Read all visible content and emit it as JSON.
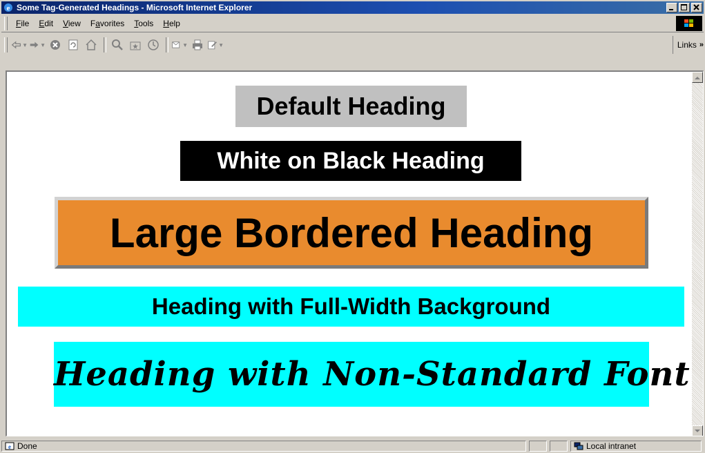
{
  "window": {
    "title": "Some Tag-Generated Headings - Microsoft Internet Explorer"
  },
  "title_buttons": {
    "minimize_icon": "minimize-icon",
    "maximize_icon": "maximize-icon",
    "close_icon": "close-icon"
  },
  "menu": {
    "items": [
      {
        "pre": "",
        "key": "F",
        "post": "ile"
      },
      {
        "pre": "",
        "key": "E",
        "post": "dit"
      },
      {
        "pre": "",
        "key": "V",
        "post": "iew"
      },
      {
        "pre": "F",
        "key": "a",
        "post": "vorites"
      },
      {
        "pre": "",
        "key": "T",
        "post": "ools"
      },
      {
        "pre": "",
        "key": "H",
        "post": "elp"
      }
    ]
  },
  "toolbar": {
    "links_label": "Links",
    "links_chevron": "»",
    "icons": [
      "back-icon",
      "forward-icon",
      "stop-icon",
      "refresh-icon",
      "home-icon",
      "search-icon",
      "favorites-icon",
      "history-icon",
      "mail-icon",
      "print-icon",
      "edit-icon"
    ]
  },
  "page": {
    "headings": {
      "default": "Default Heading",
      "white_on_black": "White on Black Heading",
      "large_bordered": "Large Bordered Heading",
      "full_width": "Heading with Full-Width Background",
      "non_standard_font": "Heading with Non-Standard Font"
    },
    "colors": {
      "default_bg": "#c0c0c0",
      "black_bg": "#000000",
      "orange_bg": "#e98b2e",
      "cyan_bg": "#00ffff"
    }
  },
  "status": {
    "text": "Done",
    "zone": "Local intranet"
  }
}
